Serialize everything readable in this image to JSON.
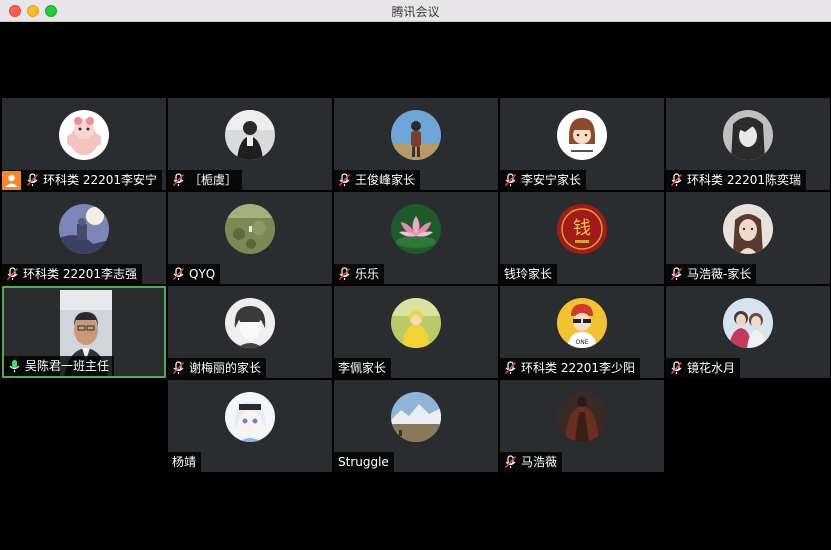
{
  "window": {
    "title": "腾讯会议"
  },
  "participants": [
    {
      "name": "环科类 22201李安宁",
      "mic": "muted",
      "host": true
    },
    {
      "name": "［栀虞］",
      "mic": "muted"
    },
    {
      "name": "王俊峰家长",
      "mic": "muted"
    },
    {
      "name": "李安宁家长",
      "mic": "muted"
    },
    {
      "name": "环科类 22201陈奕瑞",
      "mic": "muted"
    },
    {
      "name": "环科类 22201李志强",
      "mic": "muted"
    },
    {
      "name": "QYQ",
      "mic": "muted"
    },
    {
      "name": "乐乐",
      "mic": "muted"
    },
    {
      "name": "钱玲家长",
      "mic": "none"
    },
    {
      "name": "马浩薇-家长",
      "mic": "muted"
    },
    {
      "name": "吴陈君一班主任",
      "mic": "active",
      "video": true
    },
    {
      "name": "谢梅丽的家长",
      "mic": "muted"
    },
    {
      "name": "李佩家长",
      "mic": "none"
    },
    {
      "name": "环科类 22201李少阳",
      "mic": "muted"
    },
    {
      "name": "镜花水月",
      "mic": "muted"
    },
    {
      "name": "杨靖",
      "mic": "none"
    },
    {
      "name": "Struggle",
      "mic": "none"
    },
    {
      "name": "马浩薇",
      "mic": "muted"
    }
  ],
  "colors": {
    "tile": "#2b2c30",
    "active_border": "#4cae4c",
    "muted_icon": "#e0443e",
    "host_badge": "#f08a2c"
  }
}
